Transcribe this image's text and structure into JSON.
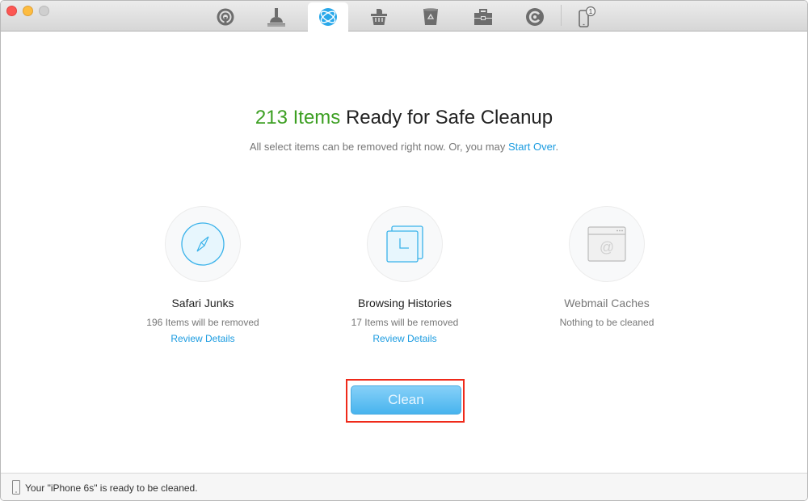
{
  "toolbar": {
    "tools": [
      {
        "name": "airbackup",
        "icon": "airbackup-icon"
      },
      {
        "name": "system-junk",
        "icon": "broom-icon"
      },
      {
        "name": "internet-junk",
        "icon": "globe-icon",
        "active": true
      },
      {
        "name": "app-junk",
        "icon": "basket-icon"
      },
      {
        "name": "user-junk",
        "icon": "recycle-bin-icon"
      },
      {
        "name": "toolbox",
        "icon": "briefcase-icon"
      },
      {
        "name": "cleaner-pro",
        "icon": "c-logo-icon"
      }
    ],
    "device_badge": "1"
  },
  "headline": {
    "count": "213 Items",
    "rest": " Ready for Safe Cleanup"
  },
  "subline": {
    "text": "All select items can be removed right now. Or, you may ",
    "link": "Start Over",
    "end": "."
  },
  "cards": [
    {
      "title": "Safari Junks",
      "sub": "196 Items will be removed",
      "link": "Review Details"
    },
    {
      "title": "Browsing Histories",
      "sub": "17 Items will be removed",
      "link": "Review Details"
    },
    {
      "title": "Webmail Caches",
      "sub": "Nothing to be cleaned"
    }
  ],
  "clean_button": "Clean",
  "status": {
    "text": "Your \"iPhone 6s\" is ready to be cleaned."
  },
  "colors": {
    "accent": "#1a9be0",
    "count_green": "#3c9f22",
    "highlight_red": "#ef2a1a"
  }
}
